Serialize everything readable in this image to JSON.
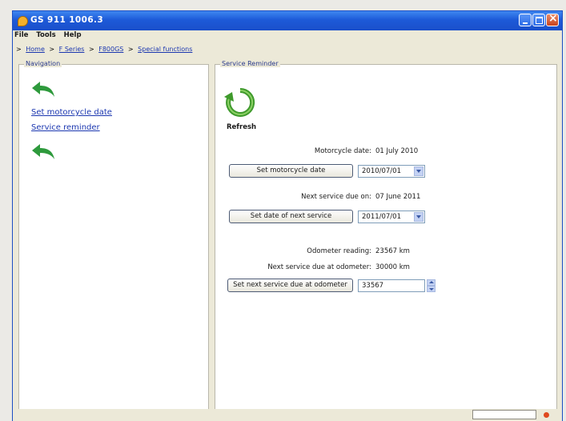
{
  "window": {
    "title": "GS 911 1006.3"
  },
  "menu": {
    "items": [
      "File",
      "Tools",
      "Help"
    ]
  },
  "breadcrumb": {
    "items": [
      "Home",
      "F Series",
      "F800GS",
      "Special functions"
    ],
    "separator": ">"
  },
  "navigation": {
    "title": "Navigation",
    "links": [
      "Set motorcycle date",
      "Service reminder"
    ]
  },
  "service_reminder": {
    "title": "Service Reminder",
    "refresh_label": "Refresh",
    "motorcycle_date_label": "Motorcycle date:",
    "motorcycle_date_value": "01 July 2010",
    "set_date_button": "Set motorcycle date",
    "set_date_input": "2010/07/01",
    "next_service_label": "Next service due on:",
    "next_service_value": "07 June 2011",
    "set_next_service_button": "Set date of next service",
    "set_next_service_input": "2011/07/01",
    "odometer_label": "Odometer reading:",
    "odometer_value": "23567 km",
    "next_odo_label": "Next service due at odometer:",
    "next_odo_value": "30000 km",
    "set_next_odo_button": "Set next service due at odometer",
    "set_next_odo_input": "33567"
  },
  "colors": {
    "titlebar": "#1d5ad8",
    "link": "#1b37b0",
    "arrow": "#2e9a3c",
    "status_led": "#e0491f"
  }
}
